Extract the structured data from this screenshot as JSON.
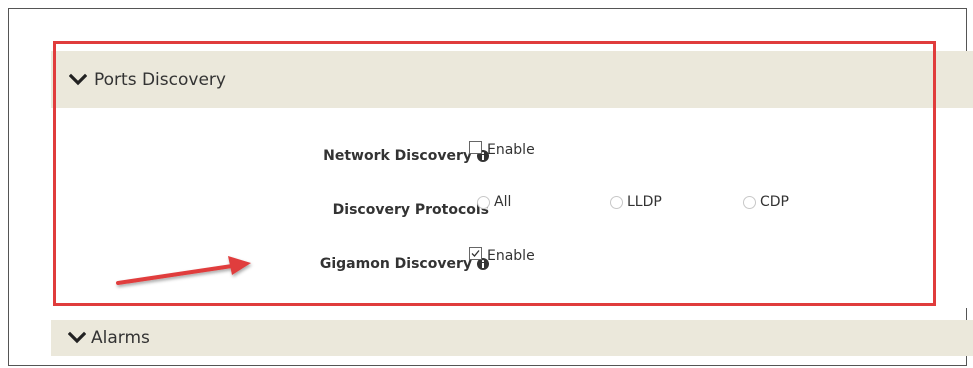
{
  "ports_section": {
    "title": "Ports Discovery",
    "expanded": true
  },
  "network_discovery": {
    "label": "Network Discovery",
    "checkbox_label": "Enable",
    "checked": false
  },
  "discovery_protocols": {
    "label": "Discovery Protocols",
    "options": [
      "All",
      "LLDP",
      "CDP"
    ],
    "selected": null
  },
  "gigamon_discovery": {
    "label": "Gigamon Discovery",
    "checkbox_label": "Enable",
    "checked": true
  },
  "alarms_section": {
    "title": "Alarms",
    "expanded": false
  },
  "colors": {
    "header_bg": "#ebe8db",
    "highlight_border": "#e03c3c",
    "annotation_arrow": "#e03c3c"
  },
  "icons": {
    "section_toggle": "chevron-down-icon",
    "info": "info-icon",
    "annotation": "red-arrow-annotation"
  }
}
